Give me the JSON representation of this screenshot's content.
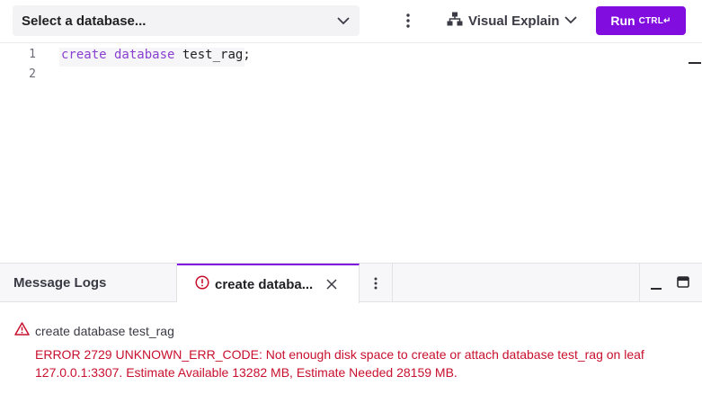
{
  "toolbar": {
    "database_select_label": "Select a database...",
    "visual_explain_label": "Visual Explain",
    "run_label": "Run",
    "run_shortcut": "CTRL↵",
    "accent_color": "#820ddf"
  },
  "editor": {
    "lines": [
      {
        "number": "1",
        "tokens": [
          {
            "text": "create database",
            "kind": "keyword"
          },
          {
            "text": " test_rag;",
            "kind": "identifier"
          }
        ]
      },
      {
        "number": "2",
        "tokens": []
      }
    ]
  },
  "panel": {
    "tabs": [
      {
        "label": "Message Logs",
        "active": false
      },
      {
        "label": "create databa...",
        "active": true,
        "icon": "alert-circle-icon"
      }
    ],
    "log": {
      "query": "create database test_rag",
      "error": "ERROR 2729 UNKNOWN_ERR_CODE: Not enough disk space to create or attach database test_rag on leaf 127.0.0.1:3307. Estimate Available 13282 MB, Estimate Needed 28159 MB.",
      "icon": "warning-triangle-icon",
      "error_color": "#c8102e"
    }
  }
}
